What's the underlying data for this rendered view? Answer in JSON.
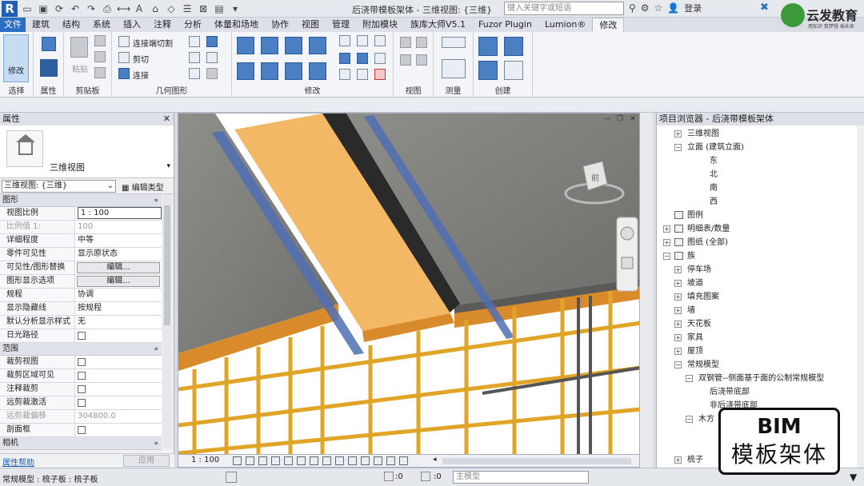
{
  "window": {
    "title": "后浇带模板架体 - 三维视图: {三维}",
    "search_placeholder": "键入关键字或短语",
    "login_label": "登录"
  },
  "brand": {
    "name": "云发教育",
    "tagline": "用知识 筑梦想 插未来"
  },
  "tabs": [
    "文件",
    "建筑",
    "结构",
    "系统",
    "插入",
    "注释",
    "分析",
    "体量和场地",
    "协作",
    "视图",
    "管理",
    "附加模块",
    "族库大师V5.1",
    "Fuzor Plugin",
    "Lumion®",
    "修改"
  ],
  "active_tab": "修改",
  "ribbon": {
    "modify_label": "修改",
    "panels": {
      "select": "选择",
      "properties": "属性",
      "clipboard": "剪贴板",
      "geometry": "几何图形",
      "modify": "修改",
      "view": "视图",
      "measure": "测量",
      "create": "创建"
    },
    "paste_label": "粘贴",
    "geometry_items": {
      "join_cut": "连接端切割",
      "cut": "剪切",
      "join": "连接"
    }
  },
  "properties": {
    "header": "属性",
    "type_name": "三维视图",
    "view_selector": "三维视图: {三维}",
    "edit_type": "编辑类型",
    "groups": {
      "graphics": "图形",
      "extents": "范围",
      "camera": "相机"
    },
    "graphics_rows": [
      {
        "key": "视图比例",
        "value": "1 : 100"
      },
      {
        "key": "比例值 1:",
        "value": "100"
      },
      {
        "key": "详细程度",
        "value": "中等"
      },
      {
        "key": "零件可见性",
        "value": "显示原状态"
      },
      {
        "key": "可见性/图形替换",
        "value": "编辑..."
      },
      {
        "key": "图形显示选项",
        "value": "编辑..."
      },
      {
        "key": "规程",
        "value": "协调"
      },
      {
        "key": "显示隐藏线",
        "value": "按规程"
      },
      {
        "key": "默认分析显示样式",
        "value": "无"
      },
      {
        "key": "日光路径",
        "value": ""
      }
    ],
    "extents_rows": [
      {
        "key": "裁剪视图",
        "value": ""
      },
      {
        "key": "裁剪区域可见",
        "value": ""
      },
      {
        "key": "注释裁剪",
        "value": ""
      },
      {
        "key": "远剪裁激活",
        "value": ""
      },
      {
        "key": "远剪裁偏移",
        "value": "304800.0"
      },
      {
        "key": "剖面框",
        "value": ""
      }
    ],
    "help_link": "属性帮助",
    "apply_label": "应用"
  },
  "viewport": {
    "scale": "1 : 100",
    "cube_face": "前"
  },
  "browser": {
    "header": "项目浏览器 - 后浇带模板架体",
    "nodes": [
      {
        "label": "三维视图",
        "toggle": "+",
        "indent": 1,
        "icon": false
      },
      {
        "label": "立面 (建筑立面)",
        "toggle": "-",
        "indent": 1,
        "icon": false
      },
      {
        "label": "东",
        "toggle": "",
        "indent": 3,
        "icon": false
      },
      {
        "label": "北",
        "toggle": "",
        "indent": 3,
        "icon": false
      },
      {
        "label": "南",
        "toggle": "",
        "indent": 3,
        "icon": false
      },
      {
        "label": "西",
        "toggle": "",
        "indent": 3,
        "icon": false
      },
      {
        "label": "图例",
        "toggle": "",
        "indent": 0,
        "icon": true
      },
      {
        "label": "明细表/数量",
        "toggle": "+",
        "indent": 0,
        "icon": true
      },
      {
        "label": "图纸 (全部)",
        "toggle": "+",
        "indent": 0,
        "icon": true
      },
      {
        "label": "族",
        "toggle": "-",
        "indent": 0,
        "icon": true
      },
      {
        "label": "停车场",
        "toggle": "+",
        "indent": 1,
        "icon": false
      },
      {
        "label": "坡道",
        "toggle": "+",
        "indent": 1,
        "icon": false
      },
      {
        "label": "填充图案",
        "toggle": "+",
        "indent": 1,
        "icon": false
      },
      {
        "label": "墙",
        "toggle": "+",
        "indent": 1,
        "icon": false
      },
      {
        "label": "天花板",
        "toggle": "+",
        "indent": 1,
        "icon": false
      },
      {
        "label": "家具",
        "toggle": "+",
        "indent": 1,
        "icon": false
      },
      {
        "label": "屋顶",
        "toggle": "+",
        "indent": 1,
        "icon": false
      },
      {
        "label": "常规模型",
        "toggle": "-",
        "indent": 1,
        "icon": false
      },
      {
        "label": "双钢管--侧面基于面的公制常规模型",
        "toggle": "-",
        "indent": 2,
        "icon": false
      },
      {
        "label": "后浇带底部",
        "toggle": "",
        "indent": 3,
        "icon": false
      },
      {
        "label": "非后浇带底部",
        "toggle": "",
        "indent": 3,
        "icon": false
      },
      {
        "label": "木方",
        "toggle": "-",
        "indent": 2,
        "icon": false
      },
      {
        "label": "",
        "toggle": "",
        "indent": 3,
        "icon": false
      },
      {
        "label": "",
        "toggle": "",
        "indent": 3,
        "icon": false
      },
      {
        "label": "梳子",
        "toggle": "+",
        "indent": 1,
        "icon": false
      }
    ]
  },
  "status": {
    "text": "常规模型 : 梳子板 : 梳子板",
    "zero_a": ":0",
    "zero_b": ":0",
    "model": "主模型"
  },
  "overlay": {
    "line1": "BIM",
    "line2": "模板架体"
  }
}
